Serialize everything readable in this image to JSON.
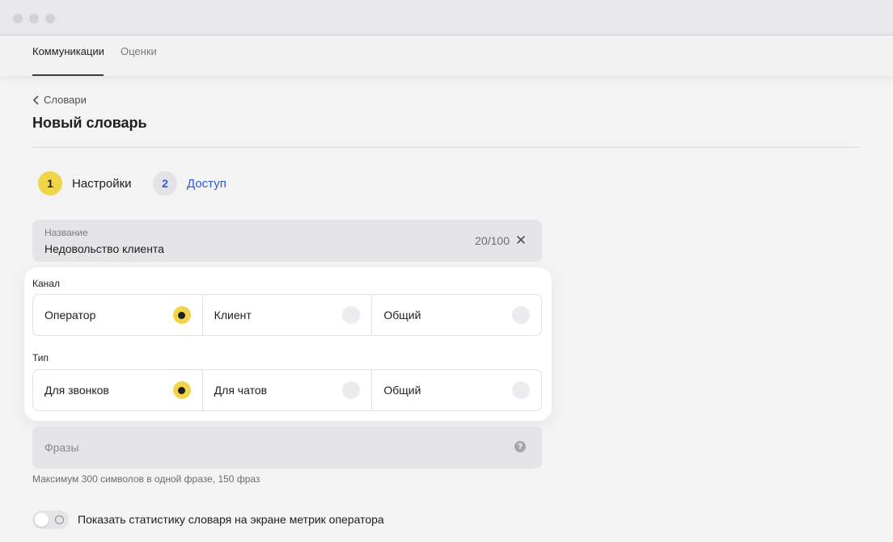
{
  "tabs": [
    {
      "label": "Коммуникации",
      "active": true
    },
    {
      "label": "Оценки",
      "active": false
    }
  ],
  "breadcrumb": {
    "label": "Словари",
    "icon": "chevron-left-icon"
  },
  "page_title": "Новый словарь",
  "steps": [
    {
      "number": "1",
      "label": "Настройки",
      "active": true
    },
    {
      "number": "2",
      "label": "Доступ",
      "active": false
    }
  ],
  "name_field": {
    "label": "Название",
    "value": "Недовольство клиента",
    "counter": "20/100",
    "clear_icon": "close-icon"
  },
  "channel": {
    "label": "Канал",
    "options": [
      {
        "label": "Оператор",
        "selected": true
      },
      {
        "label": "Клиент",
        "selected": false
      },
      {
        "label": "Общий",
        "selected": false
      }
    ]
  },
  "type": {
    "label": "Тип",
    "options": [
      {
        "label": "Для звонков",
        "selected": true
      },
      {
        "label": "Для чатов",
        "selected": false
      },
      {
        "label": "Общий",
        "selected": false
      }
    ]
  },
  "phrases": {
    "placeholder": "Фразы",
    "help_icon": "help-icon",
    "hint": "Максимум 300 символов в одной фразе, 150 фраз"
  },
  "toggle": {
    "label": "Показать статистику словаря на экране метрик оператора",
    "enabled": false
  },
  "colors": {
    "accent": "#f0d54a",
    "link": "#2f5bd6",
    "text": "#21201f"
  }
}
